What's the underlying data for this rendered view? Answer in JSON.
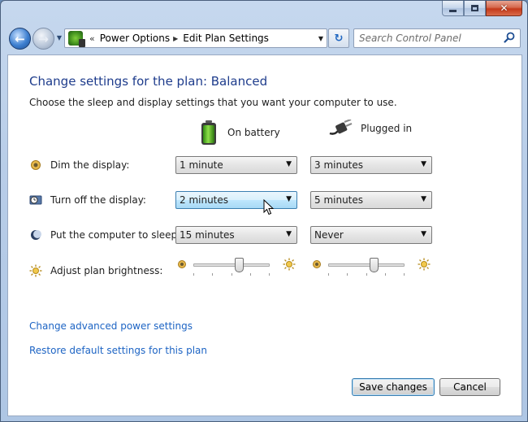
{
  "window": {
    "caption": {
      "minimize": "",
      "maximize": "",
      "close": "✕"
    }
  },
  "nav": {
    "back_glyph": "←",
    "forward_glyph": "→",
    "recent_glyph": "▼",
    "breadcrumb_prefix": "«",
    "breadcrumbs": [
      "Power Options",
      "Edit Plan Settings"
    ],
    "crumb_separator": "▶",
    "address_dropdown": "▼",
    "refresh_glyph": "↻",
    "search_placeholder": "Search Control Panel"
  },
  "header": {
    "title": "Change settings for the plan: Balanced",
    "subtitle": "Choose the sleep and display settings that you want your computer to use."
  },
  "columns": {
    "battery": "On battery",
    "plugged": "Plugged in"
  },
  "rows": [
    {
      "label": "Dim the display:",
      "icon": "dim-display-icon",
      "battery": "1 minute",
      "plugged": "3 minutes"
    },
    {
      "label": "Turn off the display:",
      "icon": "display-off-icon",
      "battery": "2 minutes",
      "plugged": "5 minutes"
    },
    {
      "label": "Put the computer to sleep:",
      "icon": "sleep-icon",
      "battery": "15 minutes",
      "plugged": "Never"
    }
  ],
  "brightness": {
    "label": "Adjust plan brightness:",
    "battery_level": 0.62,
    "plugged_level": 0.62
  },
  "links": {
    "advanced": "Change advanced power settings",
    "restore": "Restore default settings for this plan"
  },
  "buttons": {
    "save": "Save changes",
    "cancel": "Cancel"
  },
  "colors": {
    "title_blue": "#1e3c8c",
    "link_blue": "#1d64c4",
    "window_frame": "#b8cde8"
  }
}
